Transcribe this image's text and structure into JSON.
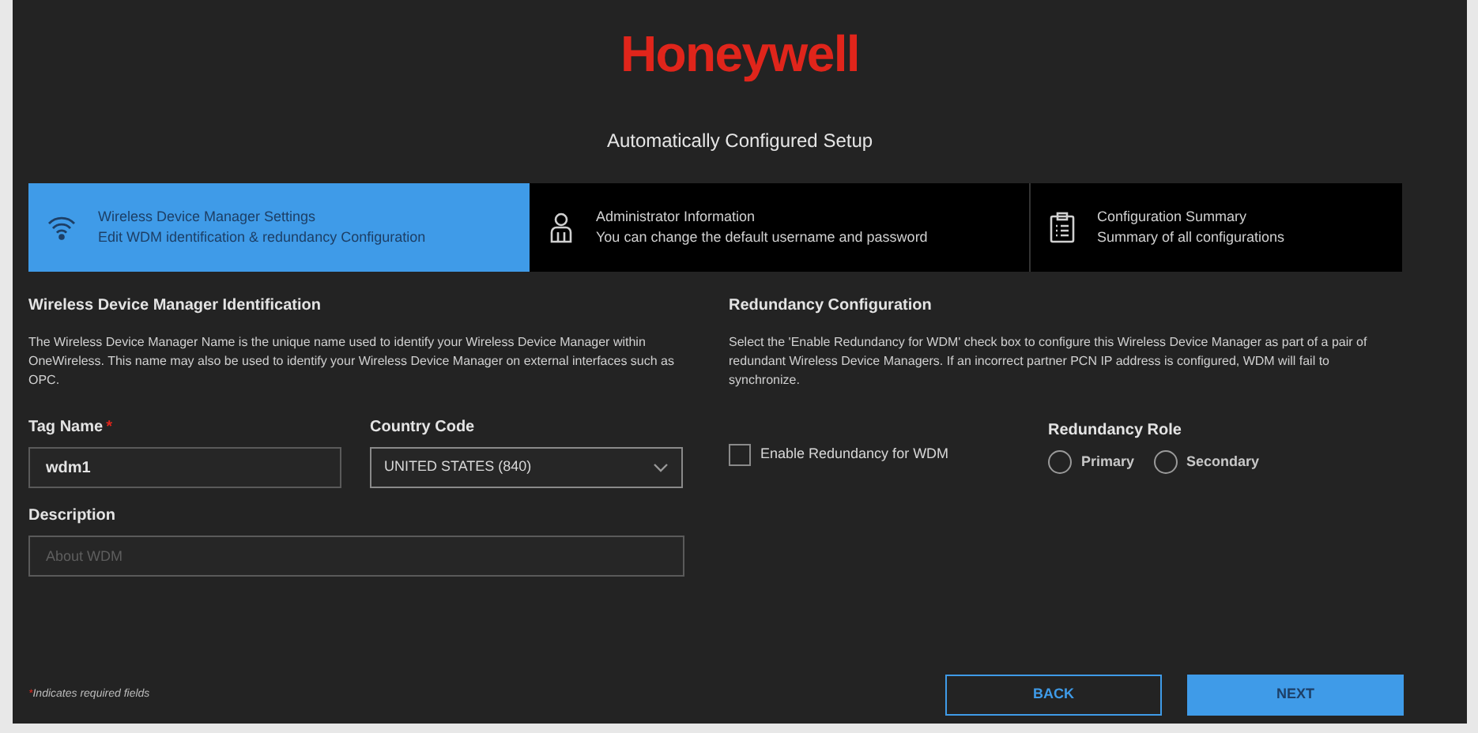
{
  "logo": "Honeywell",
  "title": "Automatically Configured Setup",
  "steps": [
    {
      "kind": "wifi",
      "title": "Wireless Device Manager Settings",
      "subtitle": "Edit WDM identification & redundancy Configuration",
      "selected": true
    },
    {
      "kind": "person",
      "title": "Administrator Information",
      "subtitle": "You can change the default username and password",
      "selected": false
    },
    {
      "kind": "clipboard",
      "title": "Configuration Summary",
      "subtitle": "Summary of all configurations",
      "selected": false
    }
  ],
  "identification": {
    "heading": "Wireless Device Manager Identification",
    "text": "The Wireless Device Manager Name is the unique name used to identify your Wireless Device Manager within OneWireless. This name may also be used to identify your Wireless Device Manager on external interfaces such as OPC.",
    "tag_name": {
      "label": "Tag Name",
      "required_mark": "*",
      "value": "wdm1"
    },
    "country_code": {
      "label": "Country Code",
      "value": "UNITED STATES (840)"
    },
    "description": {
      "label": "Description",
      "placeholder": "About WDM"
    }
  },
  "redundancy": {
    "heading": "Redundancy Configuration",
    "text": "Select the 'Enable Redundancy for WDM' check box to configure this Wireless Device Manager as part of a pair of redundant Wireless Device Managers. If an incorrect partner PCN IP address is configured, WDM will fail to synchronize.",
    "enable": {
      "label": "Enable Redundancy for WDM",
      "checked": false
    },
    "role": {
      "label": "Redundancy Role",
      "options": [
        {
          "label": "Primary",
          "selected": false
        },
        {
          "label": "Secondary",
          "selected": false
        }
      ]
    }
  },
  "required_note": {
    "mark": "*",
    "text": "Indicates required fields"
  },
  "buttons": [
    {
      "kind": "outline",
      "label": "BACK"
    },
    {
      "kind": "filled",
      "label": "NEXT"
    }
  ]
}
